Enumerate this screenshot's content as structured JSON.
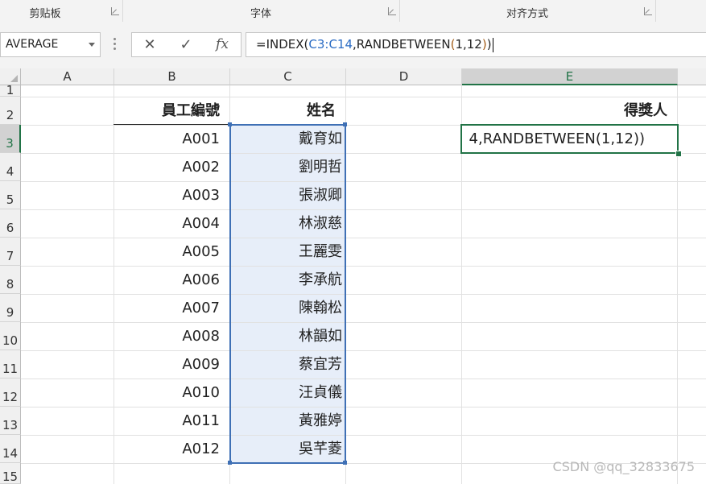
{
  "ribbon": {
    "groups": [
      {
        "label": "剪贴板"
      },
      {
        "label": "字体"
      },
      {
        "label": "对齐方式"
      }
    ]
  },
  "formula_bar": {
    "name_box": "AVERAGE",
    "cancel_icon": "✕",
    "enter_icon": "✓",
    "fx_label": "fx",
    "formula": {
      "p1": "=INDEX(",
      "ref": "C3:C14",
      "p2": ",RANDBETWEEN",
      "paren_open": "(",
      "args": "1,12",
      "paren_close": ")",
      "end": ")"
    }
  },
  "columns": [
    "A",
    "B",
    "C",
    "D",
    "E"
  ],
  "rows": [
    "1",
    "2",
    "3",
    "4",
    "5",
    "6",
    "7",
    "8",
    "9",
    "10",
    "11",
    "12",
    "13",
    "14",
    "15"
  ],
  "headers": {
    "employee_id": "員工編號",
    "name": "姓名",
    "winner": "得獎人"
  },
  "employees": [
    {
      "id": "A001",
      "name": "戴育如"
    },
    {
      "id": "A002",
      "name": "劉明哲"
    },
    {
      "id": "A003",
      "name": "張淑卿"
    },
    {
      "id": "A004",
      "name": "林淑慈"
    },
    {
      "id": "A005",
      "name": "王麗雯"
    },
    {
      "id": "A006",
      "name": "李承航"
    },
    {
      "id": "A007",
      "name": "陳翰松"
    },
    {
      "id": "A008",
      "name": "林韻如"
    },
    {
      "id": "A009",
      "name": "蔡宜芳"
    },
    {
      "id": "A010",
      "name": "汪貞儀"
    },
    {
      "id": "A011",
      "name": "黃雅婷"
    },
    {
      "id": "A012",
      "name": "吳芊菱"
    }
  ],
  "edit_cell_text": "4,RANDBETWEEN(1,12))",
  "watermark": "CSDN @qq_32833675",
  "colors": {
    "selection": "#3f70b5",
    "active_cell": "#217346"
  }
}
